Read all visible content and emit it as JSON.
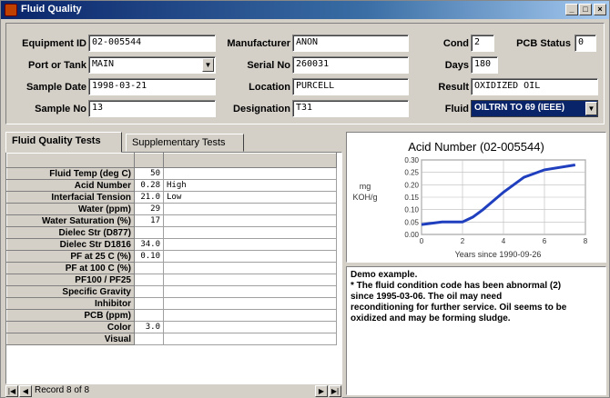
{
  "window": {
    "title": "Fluid Quality",
    "buttons": [
      "_",
      "□",
      "×"
    ]
  },
  "header": {
    "equipment_id": {
      "label": "Equipment ID",
      "value": "02-005544"
    },
    "port_or_tank": {
      "label": "Port or Tank",
      "value": "MAIN"
    },
    "sample_date": {
      "label": "Sample Date",
      "value": "1998-03-21"
    },
    "sample_no": {
      "label": "Sample No",
      "value": "13"
    },
    "manufacturer": {
      "label": "Manufacturer",
      "value": "ANON"
    },
    "serial_no": {
      "label": "Serial No",
      "value": "260031"
    },
    "location": {
      "label": "Location",
      "value": "PURCELL"
    },
    "designation": {
      "label": "Designation",
      "value": "T31"
    },
    "cond": {
      "label": "Cond",
      "value": "2"
    },
    "pcb_status": {
      "label": "PCB Status",
      "value": "0"
    },
    "days": {
      "label": "Days",
      "value": "180"
    },
    "result": {
      "label": "Result",
      "value": "OXIDIZED OIL"
    },
    "fluid": {
      "label": "Fluid",
      "value": "OILTRN TO 69 (IEEE)"
    }
  },
  "tabs": [
    {
      "label": "Fluid Quality Tests",
      "active": true
    },
    {
      "label": "Supplementary Tests",
      "active": false
    }
  ],
  "grid": {
    "rows": [
      {
        "param": "Fluid Temp (deg C)",
        "value": "50",
        "status": ""
      },
      {
        "param": "Acid Number",
        "value": "0.28",
        "status": "High"
      },
      {
        "param": "Interfacial Tension",
        "value": "21.0",
        "status": "Low"
      },
      {
        "param": "Water (ppm)",
        "value": "29",
        "status": ""
      },
      {
        "param": "Water Saturation (%)",
        "value": "17",
        "status": ""
      },
      {
        "param": "Dielec Str (D877)",
        "value": "",
        "status": ""
      },
      {
        "param": "Dielec Str D1816",
        "value": "34.0",
        "status": ""
      },
      {
        "param": "PF at 25 C (%)",
        "value": "0.10",
        "status": ""
      },
      {
        "param": "PF at 100 C (%)",
        "value": "",
        "status": ""
      },
      {
        "param": "PF100 / PF25",
        "value": "",
        "status": ""
      },
      {
        "param": "Specific Gravity",
        "value": "",
        "status": ""
      },
      {
        "param": "Inhibitor",
        "value": "",
        "status": ""
      },
      {
        "param": "PCB (ppm)",
        "value": "",
        "status": ""
      },
      {
        "param": "Color",
        "value": "3.0",
        "status": ""
      },
      {
        "param": "Visual",
        "value": "",
        "status": ""
      }
    ]
  },
  "navigator": {
    "record_text": "Record 8 of 8"
  },
  "chart_data": {
    "type": "line",
    "title": "Acid Number (02-005544)",
    "xlabel": "Years since 1990-09-26",
    "ylabel": "mg KOH/g",
    "xlim": [
      0,
      8
    ],
    "ylim": [
      0,
      0.3
    ],
    "xticks": [
      "0",
      "2",
      "4",
      "6",
      "8"
    ],
    "yticks": [
      "0.00",
      "0.05",
      "0.10",
      "0.15",
      "0.20",
      "0.25",
      "0.30"
    ],
    "grid": true,
    "series": [
      {
        "color": "#1f3fbf",
        "x": [
          0,
          1,
          2,
          2.5,
          3,
          4,
          5,
          6,
          7.5
        ],
        "y": [
          0.04,
          0.05,
          0.05,
          0.07,
          0.1,
          0.17,
          0.23,
          0.26,
          0.28
        ]
      }
    ]
  },
  "note": {
    "lines": [
      "Demo example.",
      "* The fluid condition code has been abnormal (2)",
      "since 1995-03-06. The oil may need",
      "reconditioning for further service. Oil seems to be",
      "oxidized and may be forming sludge."
    ]
  }
}
